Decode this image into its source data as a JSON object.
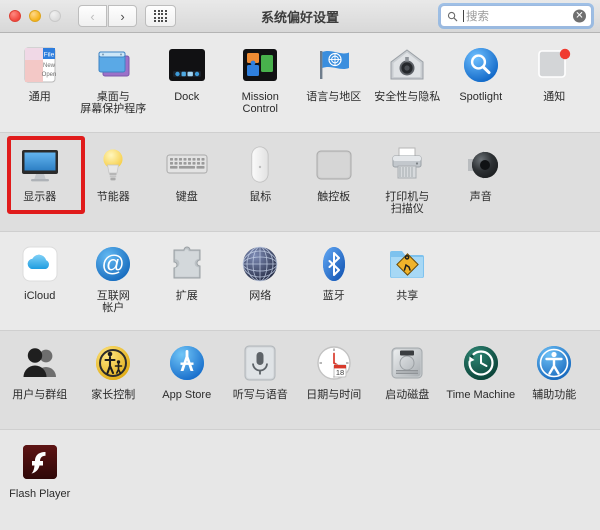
{
  "window": {
    "title": "系统偏好设置",
    "traffic_lights": [
      "close",
      "minimize",
      "zoom"
    ],
    "nav": {
      "back_label": "‹",
      "forward_label": "›",
      "grid_label": "show-all"
    },
    "search": {
      "placeholder": "搜索",
      "value": "",
      "icon": "search-icon",
      "clear_icon": "clear-icon"
    }
  },
  "annotation": {
    "color": "#e01b1b",
    "target": "显示器"
  },
  "rows": [
    {
      "id": "personal",
      "items": [
        {
          "label": "通用",
          "icon": "general-icon"
        },
        {
          "label": "桌面与\n屏幕保护程序",
          "icon": "desktop-screensaver-icon"
        },
        {
          "label": "Dock",
          "icon": "dock-icon"
        },
        {
          "label": "Mission\nControl",
          "icon": "mission-control-icon"
        },
        {
          "label": "语言与地区",
          "icon": "language-region-icon"
        },
        {
          "label": "安全性与隐私",
          "icon": "security-privacy-icon"
        },
        {
          "label": "Spotlight",
          "icon": "spotlight-icon"
        },
        {
          "label": "通知",
          "icon": "notifications-icon"
        }
      ]
    },
    {
      "id": "hardware",
      "items": [
        {
          "label": "显示器",
          "icon": "displays-icon",
          "highlighted": true
        },
        {
          "label": "节能器",
          "icon": "energy-saver-icon"
        },
        {
          "label": "键盘",
          "icon": "keyboard-icon"
        },
        {
          "label": "鼠标",
          "icon": "mouse-icon"
        },
        {
          "label": "触控板",
          "icon": "trackpad-icon"
        },
        {
          "label": "打印机与\n扫描仪",
          "icon": "printers-scanners-icon"
        },
        {
          "label": "声音",
          "icon": "sound-icon"
        }
      ]
    },
    {
      "id": "internet",
      "items": [
        {
          "label": "iCloud",
          "icon": "icloud-icon"
        },
        {
          "label": "互联网\n帐户",
          "icon": "internet-accounts-icon"
        },
        {
          "label": "扩展",
          "icon": "extensions-icon"
        },
        {
          "label": "网络",
          "icon": "network-icon"
        },
        {
          "label": "蓝牙",
          "icon": "bluetooth-icon"
        },
        {
          "label": "共享",
          "icon": "sharing-icon"
        }
      ]
    },
    {
      "id": "system",
      "items": [
        {
          "label": "用户与群组",
          "icon": "users-groups-icon"
        },
        {
          "label": "家长控制",
          "icon": "parental-controls-icon"
        },
        {
          "label": "App Store",
          "icon": "app-store-icon"
        },
        {
          "label": "听写与语音",
          "icon": "dictation-speech-icon"
        },
        {
          "label": "日期与时间",
          "icon": "date-time-icon",
          "badge": "18"
        },
        {
          "label": "启动磁盘",
          "icon": "startup-disk-icon"
        },
        {
          "label": "Time Machine",
          "icon": "time-machine-icon"
        },
        {
          "label": "辅助功能",
          "icon": "accessibility-icon"
        }
      ]
    },
    {
      "id": "other",
      "items": [
        {
          "label": "Flash Player",
          "icon": "flash-player-icon"
        }
      ]
    }
  ]
}
